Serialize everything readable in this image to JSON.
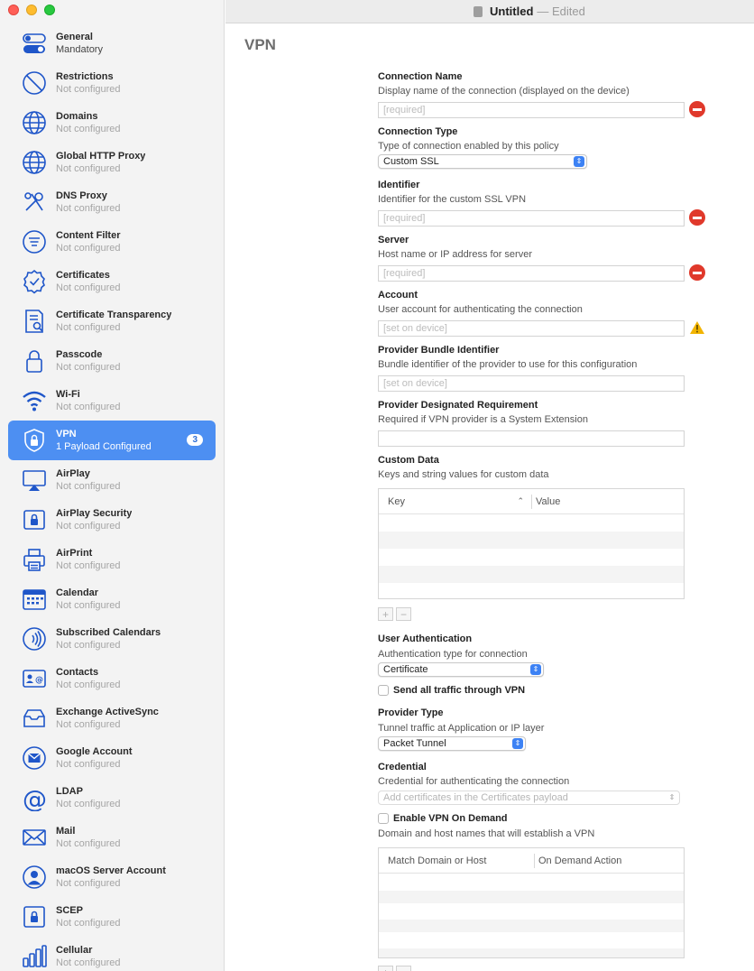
{
  "window": {
    "title": "Untitled",
    "edited": "— Edited"
  },
  "sidebar": {
    "items": [
      {
        "name": "General",
        "status": "Mandatory",
        "icon": "toggles-icon"
      },
      {
        "name": "Restrictions",
        "status": "Not configured",
        "icon": "no-entry-icon"
      },
      {
        "name": "Domains",
        "status": "Not configured",
        "icon": "globe-icon"
      },
      {
        "name": "Global HTTP Proxy",
        "status": "Not configured",
        "icon": "globe-icon"
      },
      {
        "name": "DNS Proxy",
        "status": "Not configured",
        "icon": "tools-icon"
      },
      {
        "name": "Content Filter",
        "status": "Not configured",
        "icon": "filter-icon"
      },
      {
        "name": "Certificates",
        "status": "Not configured",
        "icon": "certificate-icon"
      },
      {
        "name": "Certificate Transparency",
        "status": "Not configured",
        "icon": "document-search-icon"
      },
      {
        "name": "Passcode",
        "status": "Not configured",
        "icon": "lock-icon"
      },
      {
        "name": "Wi-Fi",
        "status": "Not configured",
        "icon": "wifi-icon"
      },
      {
        "name": "VPN",
        "status": "1 Payload Configured",
        "icon": "shield-lock-icon",
        "badge": "3"
      },
      {
        "name": "AirPlay",
        "status": "Not configured",
        "icon": "airplay-icon"
      },
      {
        "name": "AirPlay Security",
        "status": "Not configured",
        "icon": "airplay-lock-icon"
      },
      {
        "name": "AirPrint",
        "status": "Not configured",
        "icon": "printer-icon"
      },
      {
        "name": "Calendar",
        "status": "Not configured",
        "icon": "calendar-icon"
      },
      {
        "name": "Subscribed Calendars",
        "status": "Not configured",
        "icon": "broadcast-icon"
      },
      {
        "name": "Contacts",
        "status": "Not configured",
        "icon": "contacts-icon"
      },
      {
        "name": "Exchange ActiveSync",
        "status": "Not configured",
        "icon": "inbox-icon"
      },
      {
        "name": "Google Account",
        "status": "Not configured",
        "icon": "mail-circle-icon"
      },
      {
        "name": "LDAP",
        "status": "Not configured",
        "icon": "at-icon"
      },
      {
        "name": "Mail",
        "status": "Not configured",
        "icon": "envelope-icon"
      },
      {
        "name": "macOS Server Account",
        "status": "Not configured",
        "icon": "person-icon"
      },
      {
        "name": "SCEP",
        "status": "Not configured",
        "icon": "lock-square-icon"
      },
      {
        "name": "Cellular",
        "status": "Not configured",
        "icon": "signal-bars-icon"
      }
    ]
  },
  "main": {
    "title": "VPN",
    "connection_name": {
      "label": "Connection Name",
      "desc": "Display name of the connection (displayed on the device)",
      "placeholder": "[required]"
    },
    "connection_type": {
      "label": "Connection Type",
      "desc": "Type of connection enabled by this policy",
      "value": "Custom SSL"
    },
    "identifier": {
      "label": "Identifier",
      "desc": "Identifier for the custom SSL VPN",
      "placeholder": "[required]"
    },
    "server": {
      "label": "Server",
      "desc": "Host name or IP address for server",
      "placeholder": "[required]"
    },
    "account": {
      "label": "Account",
      "desc": "User account for authenticating the connection",
      "placeholder": "[set on device]"
    },
    "provider_bundle": {
      "label": "Provider Bundle Identifier",
      "desc": "Bundle identifier of the provider to use for this configuration",
      "placeholder": "[set on device]"
    },
    "provider_req": {
      "label": "Provider Designated Requirement",
      "desc": "Required if VPN provider is a System Extension",
      "placeholder": ""
    },
    "custom_data": {
      "label": "Custom Data",
      "desc": "Keys and string values for custom data",
      "col_key": "Key",
      "col_value": "Value"
    },
    "user_auth": {
      "label": "User Authentication",
      "desc": "Authentication type for connection",
      "value": "Certificate"
    },
    "send_all": {
      "label": "Send all traffic through VPN"
    },
    "provider_type": {
      "label": "Provider Type",
      "desc": "Tunnel traffic at Application or IP layer",
      "value": "Packet Tunnel"
    },
    "credential": {
      "label": "Credential",
      "desc": "Credential for authenticating the connection",
      "value": "Add certificates in the Certificates payload"
    },
    "on_demand": {
      "label": "Enable VPN On Demand",
      "desc": "Domain and host names that will establish a VPN",
      "col_match": "Match Domain or Host",
      "col_action": "On Demand Action"
    },
    "plus": "+",
    "minus": "−"
  },
  "colors": {
    "accent": "#4d8ff2",
    "required": "#e0392b",
    "warning": "#f2b400"
  }
}
